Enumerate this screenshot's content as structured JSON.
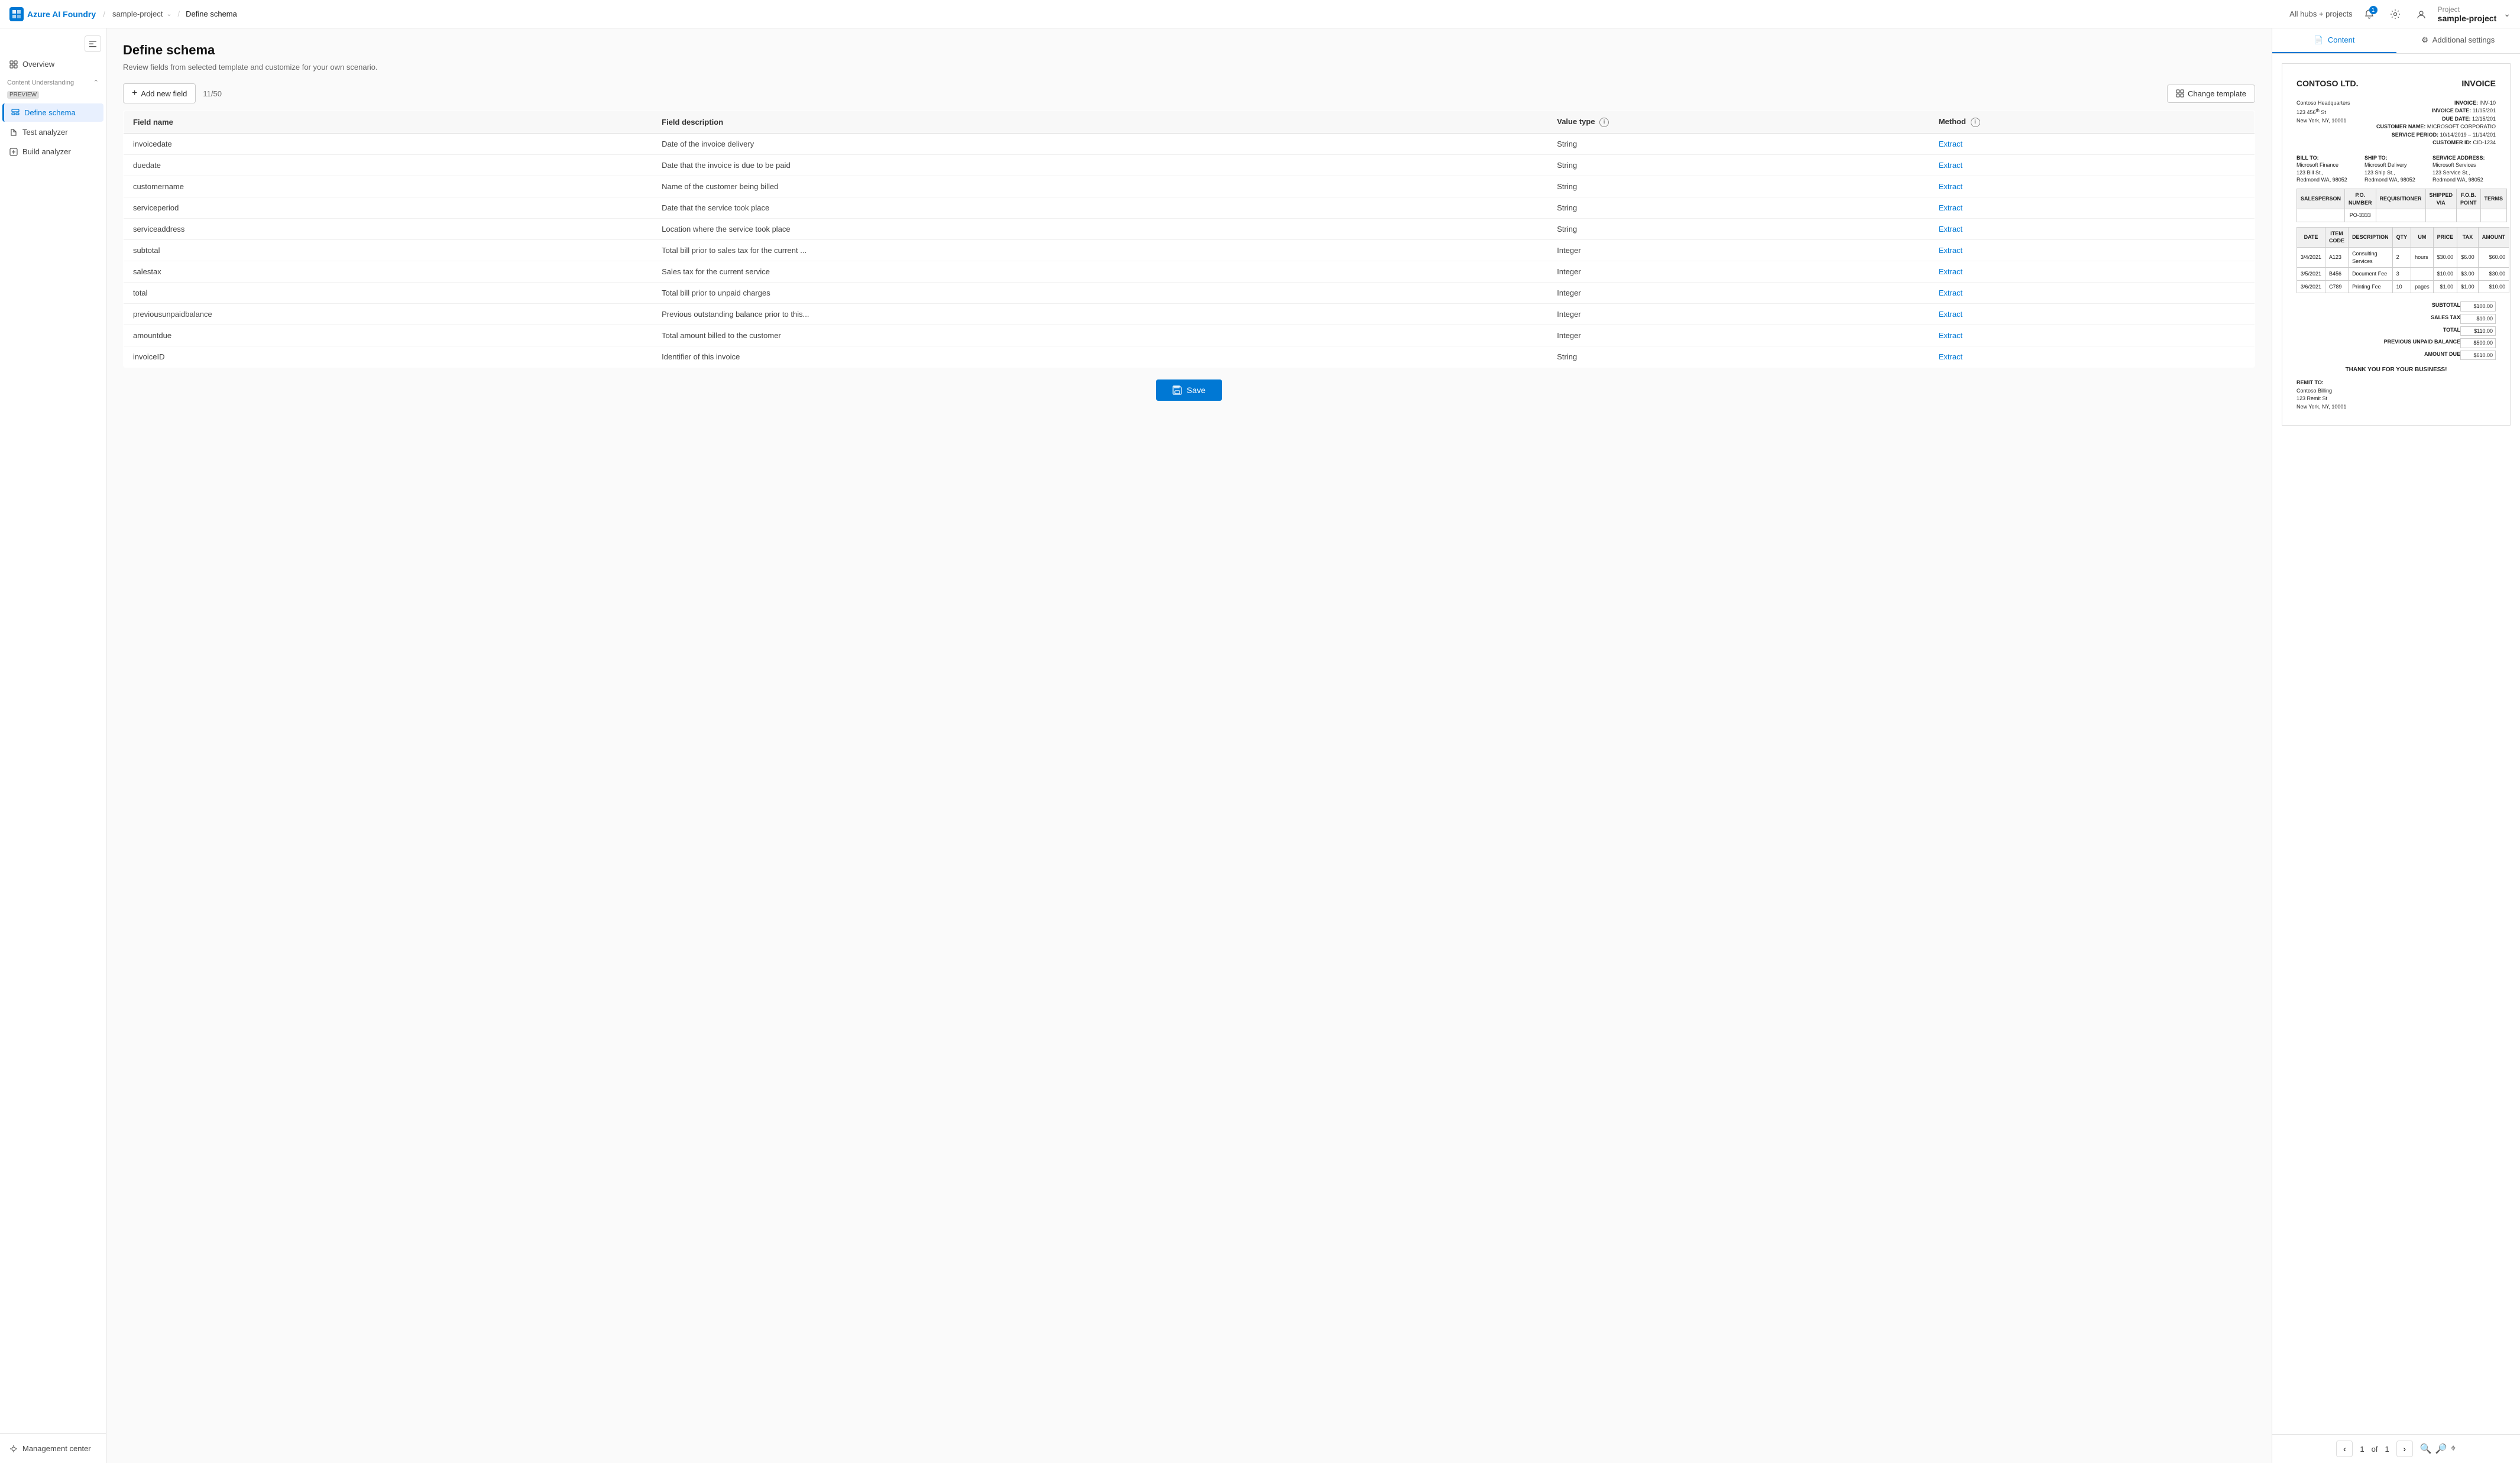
{
  "topnav": {
    "logo_text": "Azure AI Foundry",
    "breadcrumb": [
      {
        "label": "sample-project",
        "has_chevron": true
      },
      {
        "label": "Define schema"
      }
    ],
    "hubs_label": "All hubs + projects",
    "notif_count": "1",
    "project_label": "Project",
    "project_name": "sample-project"
  },
  "sidebar": {
    "toggle_icon": "⊟",
    "overview_label": "Overview",
    "section_label": "Content Understanding",
    "section_badge": "PREVIEW",
    "items": [
      {
        "id": "define-schema",
        "label": "Define schema",
        "active": true,
        "icon": "schema"
      },
      {
        "id": "test-analyzer",
        "label": "Test analyzer",
        "active": false,
        "icon": "test"
      },
      {
        "id": "build-analyzer",
        "label": "Build analyzer",
        "active": false,
        "icon": "build"
      }
    ],
    "management_label": "Management center"
  },
  "page": {
    "title": "Define schema",
    "subtitle": "Review fields from selected template and customize for your own scenario."
  },
  "toolbar": {
    "add_label": "Add new field",
    "field_count": "11/50",
    "change_template_label": "Change template"
  },
  "table": {
    "columns": [
      "Field name",
      "Field description",
      "Value type",
      "Method"
    ],
    "rows": [
      {
        "name": "invoicedate",
        "description": "Date of the invoice delivery",
        "value_type": "String",
        "method": "Extract"
      },
      {
        "name": "duedate",
        "description": "Date that the invoice is due to be paid",
        "value_type": "String",
        "method": "Extract"
      },
      {
        "name": "customername",
        "description": "Name of the customer being billed",
        "value_type": "String",
        "method": "Extract"
      },
      {
        "name": "serviceperiod",
        "description": "Date that the service took place",
        "value_type": "String",
        "method": "Extract"
      },
      {
        "name": "serviceaddress",
        "description": "Location where the service took place",
        "value_type": "String",
        "method": "Extract"
      },
      {
        "name": "subtotal",
        "description": "Total bill prior to sales tax for the current ...",
        "value_type": "Integer",
        "method": "Extract"
      },
      {
        "name": "salestax",
        "description": "Sales tax for the current service",
        "value_type": "Integer",
        "method": "Extract"
      },
      {
        "name": "total",
        "description": "Total bill prior to unpaid charges",
        "value_type": "Integer",
        "method": "Extract"
      },
      {
        "name": "previousunpaidbalance",
        "description": "Previous outstanding balance prior to this...",
        "value_type": "Integer",
        "method": "Extract"
      },
      {
        "name": "amountdue",
        "description": "Total amount billed to the customer",
        "value_type": "Integer",
        "method": "Extract"
      },
      {
        "name": "invoiceID",
        "description": "Identifier of this invoice",
        "value_type": "String",
        "method": "Extract"
      }
    ]
  },
  "save_button_label": "Save",
  "right_panel": {
    "tabs": [
      {
        "id": "content",
        "label": "Content",
        "icon": "doc",
        "active": true
      },
      {
        "id": "additional-settings",
        "label": "Additional settings",
        "icon": "settings",
        "active": false
      }
    ],
    "doc_nav": {
      "page_current": "1",
      "page_total": "1"
    },
    "invoice": {
      "company": "CONTOSO LTD.",
      "title": "INVOICE",
      "address_block": "Contoso Headquarters\n123 456th St\nNew York, NY, 10001",
      "inv_number": "INV-10",
      "inv_date": "11/15/201",
      "due_date": "12/15/201",
      "customer_name": "MICROSOFT CORPORATIO",
      "service_period": "10/14/2019 - 11/14/201",
      "customer_id": "CID-1234",
      "bill_to": "Microsoft Finance\n123 Bill St.,\nRedmond WA, 98052",
      "ship_to": "Microsoft Delivery\n123 Ship St.,\nRedmond WA, 98052",
      "service_address": "Microsoft Services\n123 Service St.,\nRedmond WA, 98052",
      "po_number": "PO-3333",
      "items": [
        {
          "date": "3/4/2021",
          "code": "A123",
          "desc": "Consulting Services",
          "qty": "2",
          "um": "hours",
          "price": "$30.00",
          "tax": "$6.00",
          "amount": "$60.00"
        },
        {
          "date": "3/5/2021",
          "code": "B456",
          "desc": "Document Fee",
          "qty": "3",
          "um": "",
          "price": "$10.00",
          "tax": "$3.00",
          "amount": "$30.00"
        },
        {
          "date": "3/6/2021",
          "code": "C789",
          "desc": "Printing Fee",
          "qty": "10",
          "um": "pages",
          "price": "$1.00",
          "tax": "$1.00",
          "amount": "$10.00"
        }
      ],
      "subtotal": "$100.00",
      "sales_tax": "$10.00",
      "total": "$110.00",
      "prev_unpaid": "$500.00",
      "amount_due": "$610.00",
      "thank_you": "THANK YOU FOR YOUR BUSINESS!",
      "remit_to": "Contoso Billing\n123 Remit St\nNew York, NY, 10001"
    }
  }
}
